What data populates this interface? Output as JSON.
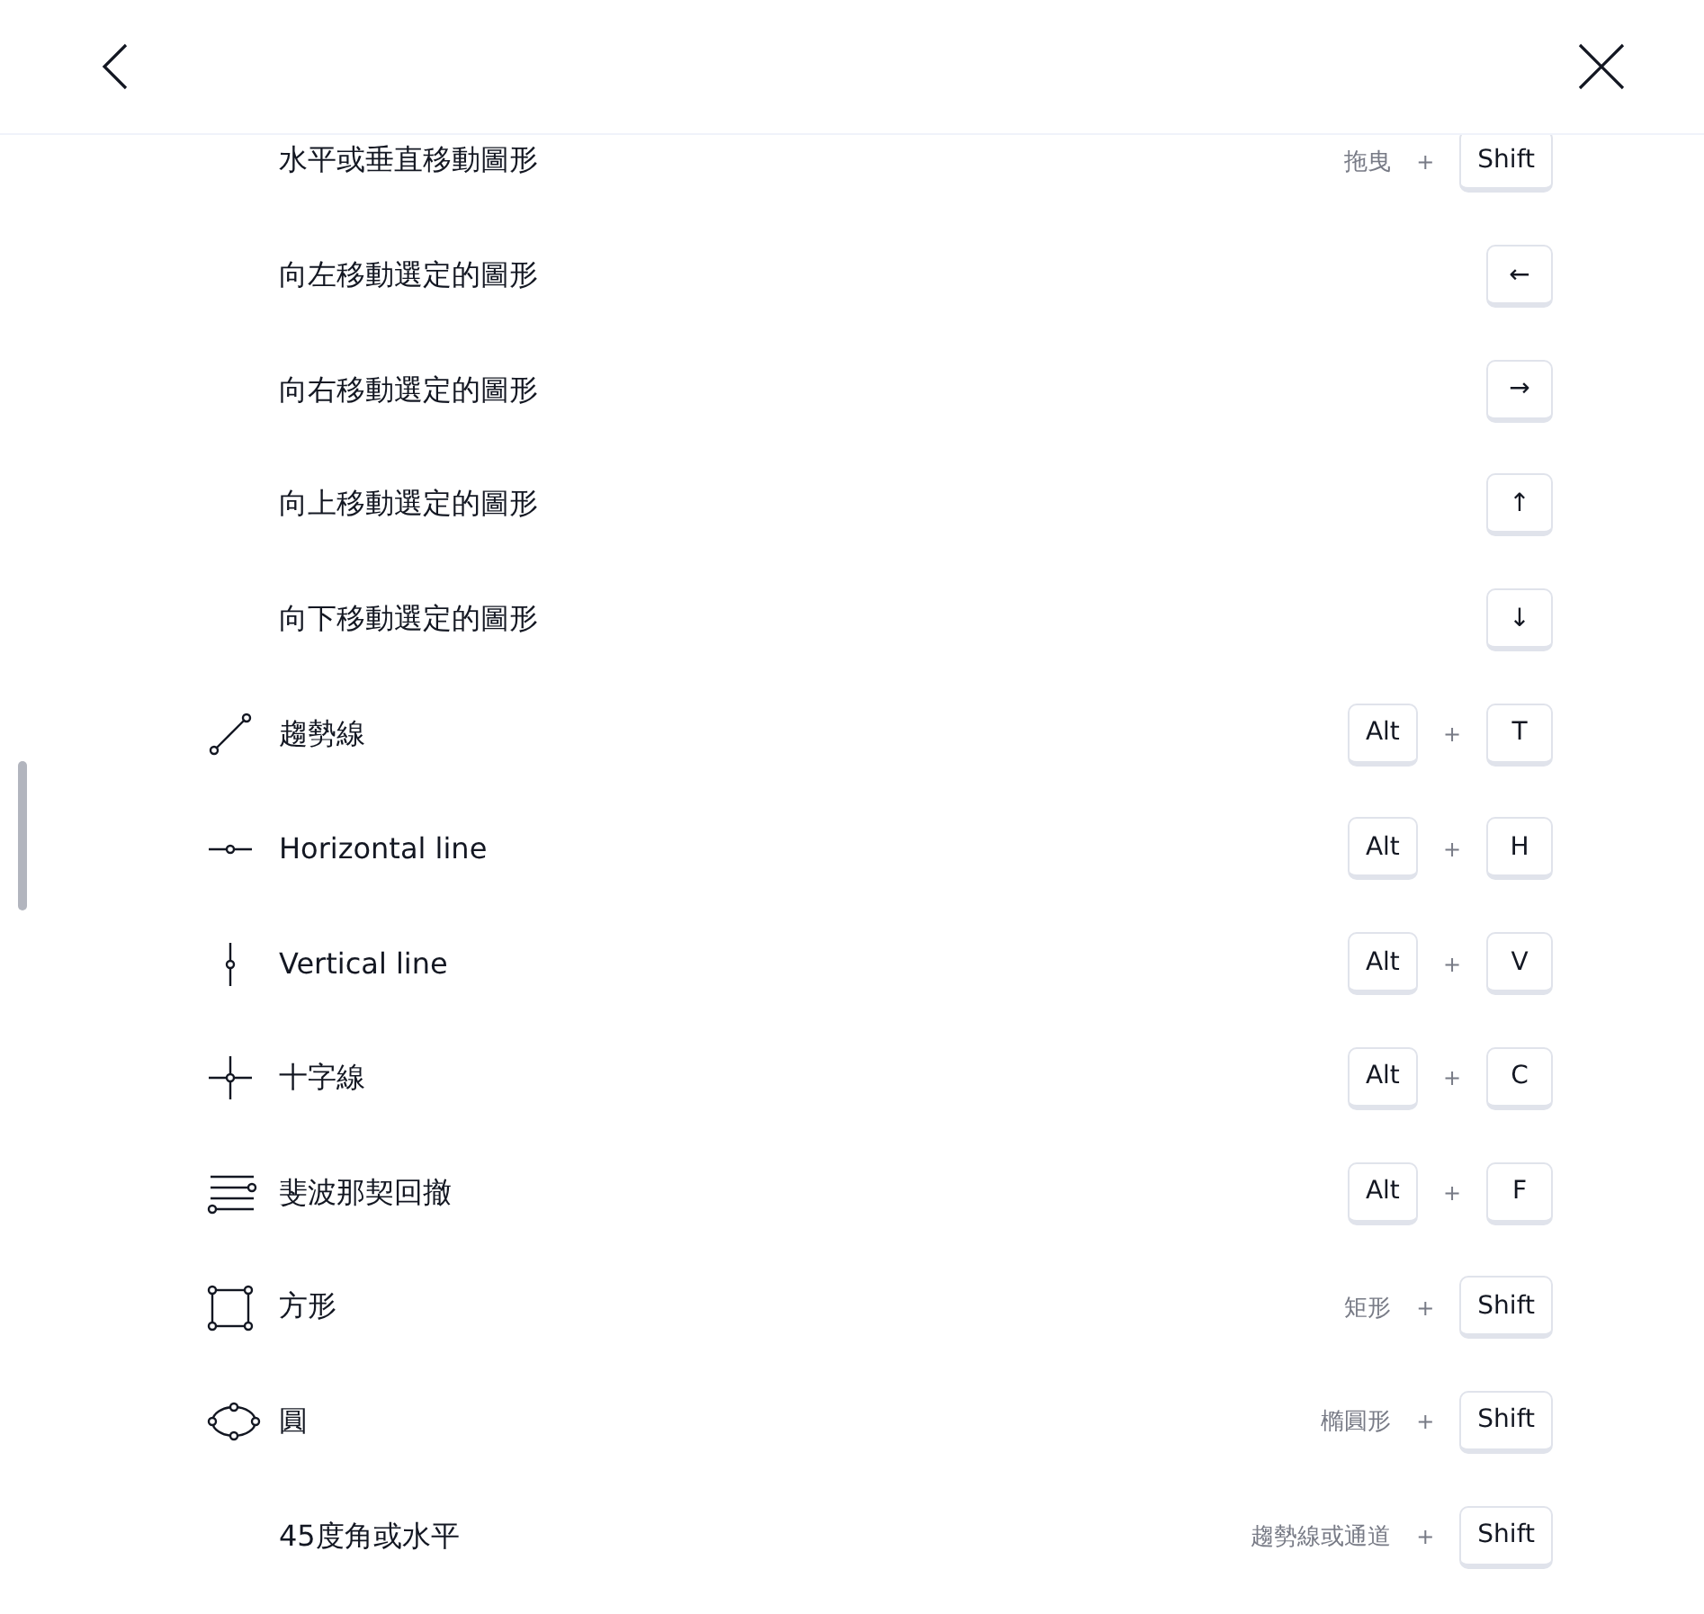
{
  "rows": [
    {
      "label": "水平或垂直移動圖形",
      "kind": "plain",
      "keys": [
        {
          "kind": "hint",
          "text": "拖曳"
        },
        {
          "kind": "plus",
          "text": "+"
        },
        {
          "kind": "key",
          "text": "Shift"
        }
      ]
    },
    {
      "label": "向左移動選定的圖形",
      "kind": "plain",
      "keys": [
        {
          "kind": "key",
          "text": "←"
        }
      ]
    },
    {
      "label": "向右移動選定的圖形",
      "kind": "plain",
      "keys": [
        {
          "kind": "key",
          "text": "→"
        }
      ]
    },
    {
      "label": "向上移動選定的圖形",
      "kind": "plain",
      "keys": [
        {
          "kind": "key",
          "text": "↑"
        }
      ]
    },
    {
      "label": "向下移動選定的圖形",
      "kind": "plain",
      "keys": [
        {
          "kind": "key",
          "text": "↓"
        }
      ]
    },
    {
      "label": "趨勢線",
      "kind": "trend",
      "keys": [
        {
          "kind": "key",
          "text": "Alt"
        },
        {
          "kind": "plus",
          "text": "+"
        },
        {
          "kind": "key",
          "text": "T"
        }
      ]
    },
    {
      "label": "Horizontal line",
      "kind": "hline",
      "keys": [
        {
          "kind": "key",
          "text": "Alt"
        },
        {
          "kind": "plus",
          "text": "+"
        },
        {
          "kind": "key",
          "text": "H"
        }
      ]
    },
    {
      "label": "Vertical line",
      "kind": "vline",
      "keys": [
        {
          "kind": "key",
          "text": "Alt"
        },
        {
          "kind": "plus",
          "text": "+"
        },
        {
          "kind": "key",
          "text": "V"
        }
      ]
    },
    {
      "label": "十字線",
      "kind": "cross",
      "keys": [
        {
          "kind": "key",
          "text": "Alt"
        },
        {
          "kind": "plus",
          "text": "+"
        },
        {
          "kind": "key",
          "text": "C"
        }
      ]
    },
    {
      "label": "斐波那契回撤",
      "kind": "fib",
      "keys": [
        {
          "kind": "key",
          "text": "Alt"
        },
        {
          "kind": "plus",
          "text": "+"
        },
        {
          "kind": "key",
          "text": "F"
        }
      ]
    },
    {
      "label": "方形",
      "kind": "rect",
      "keys": [
        {
          "kind": "hint",
          "text": "矩形"
        },
        {
          "kind": "plus",
          "text": "+"
        },
        {
          "kind": "key",
          "text": "Shift"
        }
      ]
    },
    {
      "label": "圓",
      "kind": "ellipse",
      "keys": [
        {
          "kind": "hint",
          "text": "橢圓形"
        },
        {
          "kind": "plus",
          "text": "+"
        },
        {
          "kind": "key",
          "text": "Shift"
        }
      ]
    },
    {
      "label": "45度角或水平",
      "kind": "plain",
      "keys": [
        {
          "kind": "hint",
          "text": "趨勢線或通道"
        },
        {
          "kind": "plus",
          "text": "+"
        },
        {
          "kind": "key",
          "text": "Shift"
        }
      ]
    }
  ]
}
